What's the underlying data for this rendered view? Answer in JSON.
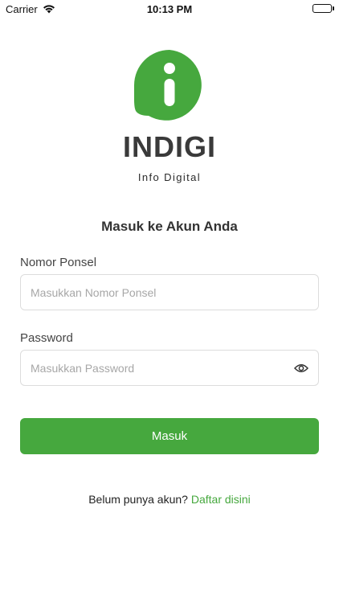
{
  "status_bar": {
    "carrier": "Carrier",
    "time": "10:13 PM",
    "icons": [
      "wifi-icon",
      "battery-icon"
    ]
  },
  "brand": {
    "name": "INDIGI",
    "tagline": "Info Digital",
    "logo_icon": "info-logo-icon",
    "accent_color": "#46a83e"
  },
  "form": {
    "title": "Masuk ke Akun Anda",
    "phone": {
      "label": "Nomor Ponsel",
      "placeholder": "Masukkan Nomor Ponsel",
      "value": ""
    },
    "password": {
      "label": "Password",
      "placeholder": "Masukkan Password",
      "value": "",
      "toggle_icon": "eye-icon"
    },
    "submit_label": "Masuk"
  },
  "signup": {
    "prompt": "Belum punya akun?",
    "link_label": "Daftar disini"
  }
}
